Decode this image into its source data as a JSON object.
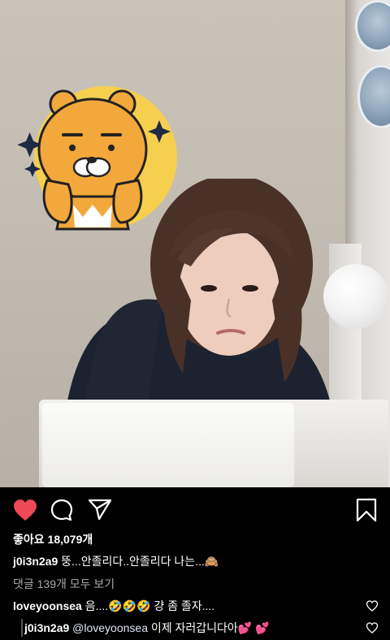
{
  "post": {
    "likes_text": "좋아요 18,079개",
    "caption_user": "j0i3n2a9",
    "caption_text": "뚱...안졸리다..안졸리다 나는...🙈",
    "view_comments": "댓글 139개 모두 보기"
  },
  "comments": [
    {
      "user": "loveyoonsea",
      "text": "음....🤣🤣🤣 걍 좀 졸자...."
    }
  ],
  "reply": {
    "user": "j0i3n2a9",
    "mention": "@loveyoonsea",
    "text": "이제 자러갑니다아💕 💕"
  },
  "icons": {
    "like": "heart-filled-icon",
    "comment": "comment-bubble-icon",
    "share": "paper-plane-icon",
    "save": "bookmark-icon",
    "character": "ryan-character-sticker"
  },
  "colors": {
    "background": "#000000",
    "like_red": "#ed4956",
    "muted_text": "#a8a8a8",
    "sticker_circle": "#f6cf4f",
    "ryan_fur": "#f3a83b"
  }
}
